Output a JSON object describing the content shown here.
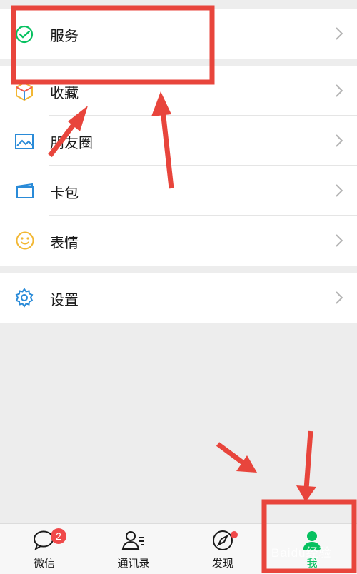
{
  "menu": {
    "services": {
      "label": "服务",
      "icon": "wechat-pay-icon"
    },
    "favorites": {
      "label": "收藏",
      "icon": "cube-icon"
    },
    "moments": {
      "label": "朋友圈",
      "icon": "picture-icon"
    },
    "cards": {
      "label": "卡包",
      "icon": "card-wallet-icon"
    },
    "stickers": {
      "label": "表情",
      "icon": "smiley-icon"
    },
    "settings": {
      "label": "设置",
      "icon": "gear-icon"
    }
  },
  "tabbar": {
    "chats": {
      "label": "微信",
      "badge": "2"
    },
    "contacts": {
      "label": "通讯录"
    },
    "discover": {
      "label": "发现",
      "has_dot": true
    },
    "me": {
      "label": "我",
      "active": true
    }
  },
  "watermark": "Baidu经验",
  "colors": {
    "accent": "#07c160",
    "annotation": "#e8453c",
    "badge": "#f0494a"
  }
}
